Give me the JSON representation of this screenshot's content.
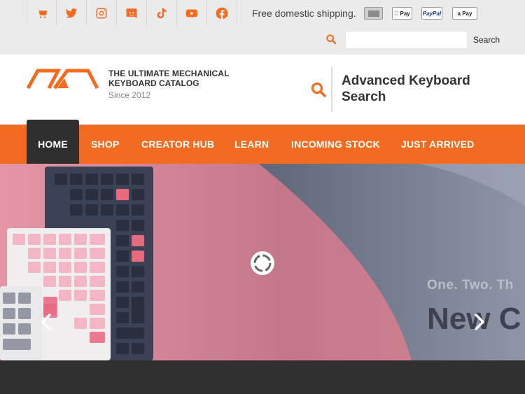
{
  "topbar": {
    "social": [
      {
        "icon": "cart-icon",
        "name": "cart"
      },
      {
        "icon": "twitter-icon",
        "name": "twitter"
      },
      {
        "icon": "instagram-icon",
        "name": "instagram"
      },
      {
        "icon": "discord-icon",
        "name": "discord"
      },
      {
        "icon": "tiktok-icon",
        "name": "tiktok"
      },
      {
        "icon": "youtube-icon",
        "name": "youtube"
      },
      {
        "icon": "facebook-icon",
        "name": "facebook"
      }
    ],
    "shipping_text": "Free domestic shipping.",
    "payments": {
      "apple": " Pay",
      "paypal": "PayPal",
      "amazon": "a Pay"
    },
    "search_placeholder": "",
    "search_button": "Search"
  },
  "header": {
    "brand_line1": "THE ULTIMATE MECHANICAL",
    "brand_line2": "KEYBOARD CATALOG",
    "since": "Since 2012",
    "advanced_search": "Advanced Keyboard Search"
  },
  "nav": {
    "items": [
      {
        "label": "HOME",
        "active": true
      },
      {
        "label": "SHOP"
      },
      {
        "label": "CREATOR HUB"
      },
      {
        "label": "LEARN"
      },
      {
        "label": "INCOMING STOCK"
      },
      {
        "label": "JUST ARRIVED"
      }
    ]
  },
  "hero": {
    "tagline": "One. Two. Th",
    "title": "New C"
  },
  "colors": {
    "accent": "#f26b21",
    "nav_active": "#2e2e2e",
    "topbar_bg": "#ebebeb",
    "dark_footer": "#303030"
  }
}
